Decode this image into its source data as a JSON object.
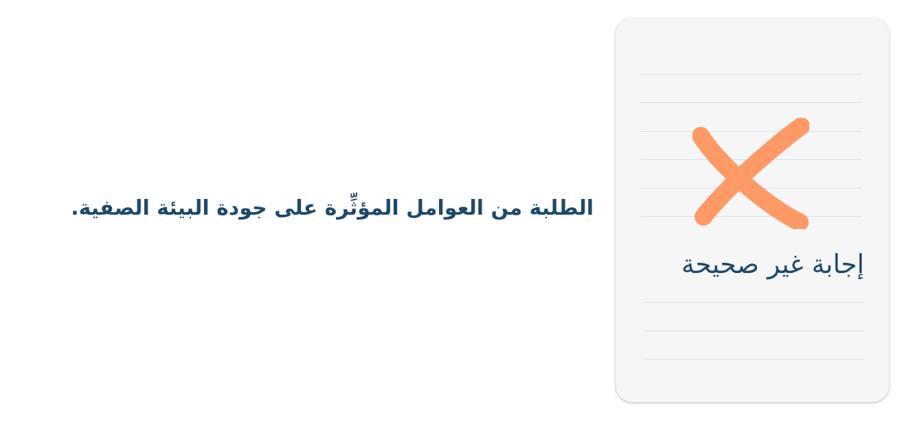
{
  "question": {
    "statement": "الطلبة من العوامل المؤثِّرة على جودة البيئة الصفية."
  },
  "feedback_card": {
    "verdict_label": "إجابة غير صحيحة",
    "icon": "x-mark-icon"
  },
  "colors": {
    "text": "#1e4a6b",
    "mark": "#ff9966",
    "card_background": "#f6f6f7",
    "ruled_line": "#cfe3e7"
  }
}
